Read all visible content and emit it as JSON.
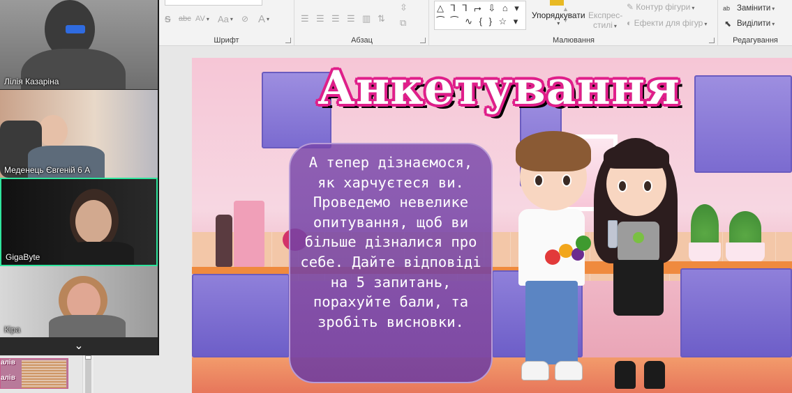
{
  "ribbon": {
    "groups": {
      "font": "Шрифт",
      "paragraph": "Абзац",
      "drawing": "Малювання",
      "editing": "Редагування"
    },
    "font_tools": [
      "S",
      "abc",
      "AV",
      "Aa",
      "A"
    ],
    "shapes_row1": "△ ⅂ ⅂ ⮣ ⇩ ⌂ ▾",
    "shapes_row2": "⁀ ⁀ ∿ { } ☆ ▾",
    "arrange_label": "Упорядкувати",
    "quick_styles_label": "Експрес-",
    "quick_styles_label2": "стилі",
    "shape_outline_label": "Контур фігури",
    "shape_effects_label": "Ефекти для фігур",
    "replace_label": "Замінити",
    "select_label": "Виділити",
    "icons": {
      "replace": "ab-replace-icon",
      "select": "cursor-select-icon"
    }
  },
  "participants": [
    {
      "name": "Лілія Казаріна",
      "active": false
    },
    {
      "name": "Меденець Євгеній 6 А",
      "active": false
    },
    {
      "name": "GigaByte",
      "active": true
    },
    {
      "name": "Кіра",
      "active": false
    }
  ],
  "panel_toggle": "⌄",
  "thumbnail": {
    "text_line1": "алів",
    "text_line2": "алів"
  },
  "slide": {
    "title": "Анкетування",
    "body": "А тепер дізнаємося, як харчуєтеся ви. Проведемо невелике опитування, щоб ви більше дізналися про себе. Дайте відповіді на 5 запитань, порахуйте бали, та зробіть висновки."
  },
  "colors": {
    "active_tile_border": "#2ee59d",
    "title_outline": "#e01e8a",
    "bubble": "#7a46aa"
  }
}
